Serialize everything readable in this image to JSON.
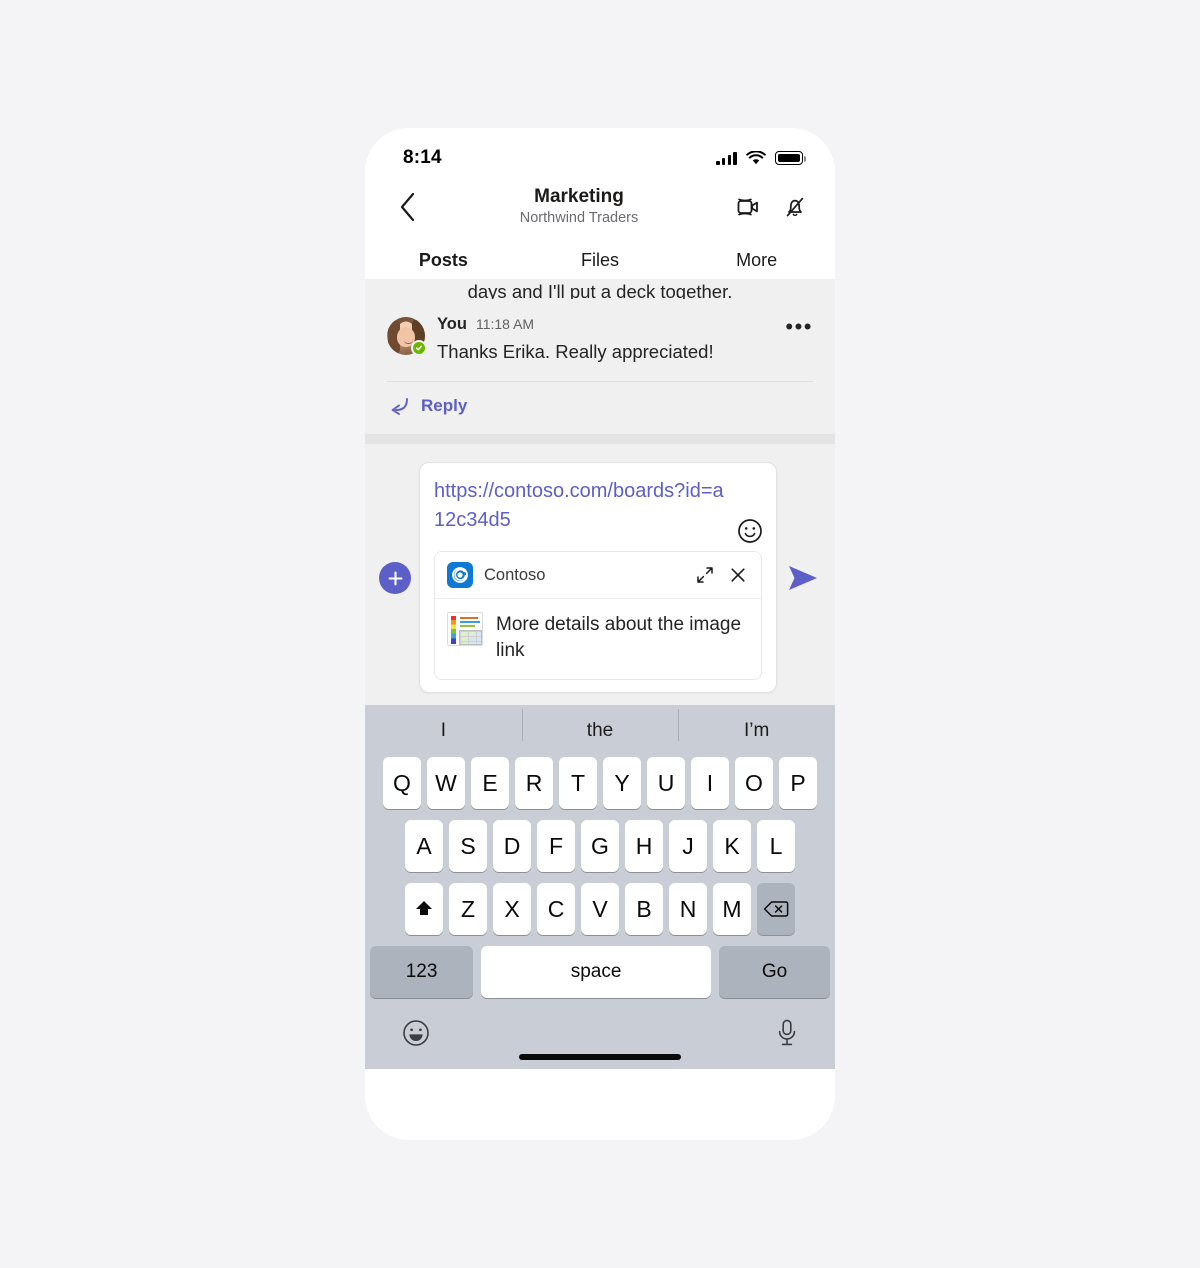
{
  "status_bar": {
    "time": "8:14",
    "signal_icon": "cellular-signal-icon",
    "wifi_icon": "wifi-icon",
    "battery_icon": "battery-icon"
  },
  "header": {
    "back_icon": "chevron-left-icon",
    "title": "Marketing",
    "subtitle": "Northwind Traders",
    "meet_icon": "video-camera-icon",
    "notifications_icon": "bell-muted-icon"
  },
  "tabs": [
    {
      "label": "Posts",
      "active": true
    },
    {
      "label": "Files",
      "active": false
    },
    {
      "label": "More",
      "active": false
    }
  ],
  "thread": {
    "truncated_message": "days and I'll put a deck together.",
    "message": {
      "author": "You",
      "time": "11:18 AM",
      "text": "Thanks Erika. Really appreciated!",
      "more_icon": "ellipsis-icon",
      "presence": "available",
      "avatar_icon": "user-avatar-photo"
    },
    "reply": {
      "icon": "reply-arrow-icon",
      "label": "Reply"
    }
  },
  "compose": {
    "attach_icon": "plus-icon",
    "message_text": "https://contoso.com/boards?id=a12c34d5",
    "emoji_icon": "smiley-icon",
    "send_icon": "send-arrow-icon",
    "link_card": {
      "app_icon": "contoso-app-icon",
      "app_name": "Contoso",
      "expand_icon": "expand-diagonal-icon",
      "close_icon": "close-x-icon",
      "thumbnail_icon": "chart-thumbnail-image",
      "title": "More details about the image link"
    }
  },
  "keyboard": {
    "suggestions": [
      "I",
      "the",
      "I’m"
    ],
    "row1": [
      "Q",
      "W",
      "E",
      "R",
      "T",
      "Y",
      "U",
      "I",
      "O",
      "P"
    ],
    "row2": [
      "A",
      "S",
      "D",
      "F",
      "G",
      "H",
      "J",
      "K",
      "L"
    ],
    "row3": [
      "Z",
      "X",
      "C",
      "V",
      "B",
      "N",
      "M"
    ],
    "shift_icon": "shift-arrow-icon",
    "backspace_icon": "backspace-icon",
    "numbers_key": "123",
    "space_key": "space",
    "return_key": "Go",
    "emoji_key_icon": "emoji-face-icon",
    "dictation_icon": "microphone-icon"
  },
  "colors": {
    "accent": "#5b5fc7",
    "app_icon_blue": "#0f78d4",
    "presence_green": "#6bb700",
    "keyboard_bg": "#c9cdd6",
    "page_bg": "#f4f4f6"
  }
}
